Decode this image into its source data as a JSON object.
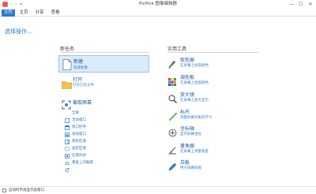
{
  "window": {
    "title": "PicPick 图像编辑器",
    "minimize": "—",
    "maximize": "☐",
    "close": "✕"
  },
  "quick_access": {
    "back": "‹",
    "forward": "›",
    "dropdown": "▾"
  },
  "tabs": [
    "文件",
    "主页",
    "分享",
    "查看"
  ],
  "prompt": "选择操作...",
  "left": {
    "heading": "新任务",
    "new": {
      "title": "新建",
      "subtitle": "新建图像"
    },
    "open": {
      "title": "打开",
      "subtitle": "打开已有文件"
    },
    "capture": {
      "title": "截取屏幕",
      "items": [
        "全屏",
        "活动窗口",
        "窗口控件",
        "滚动窗口",
        "矩形区域",
        "固定区域",
        "任意形状",
        "重复上次截取"
      ]
    }
  },
  "right": {
    "heading": "实用工具",
    "tools": [
      {
        "title": "取色器",
        "subtitle": "在屏幕上拾取颜色"
      },
      {
        "title": "调色板",
        "subtitle": "在屏幕上拾取颜色"
      },
      {
        "title": "放大镜",
        "subtitle": "在屏幕上放大显示"
      },
      {
        "title": "标尺",
        "subtitle": "测量屏幕对象的尺寸"
      },
      {
        "title": "坐标轴",
        "subtitle": "显示屏幕坐标"
      },
      {
        "title": "量角器",
        "subtitle": "在屏幕上测量角度"
      },
      {
        "title": "白板",
        "subtitle": "用于屏幕绘图"
      }
    ]
  },
  "status": {
    "checkbox_label": "启动时不再显示此窗口"
  },
  "colors": {
    "accent": "#2b78d0",
    "link": "#1e5aa0",
    "selected_bg": "#dcebfa"
  }
}
